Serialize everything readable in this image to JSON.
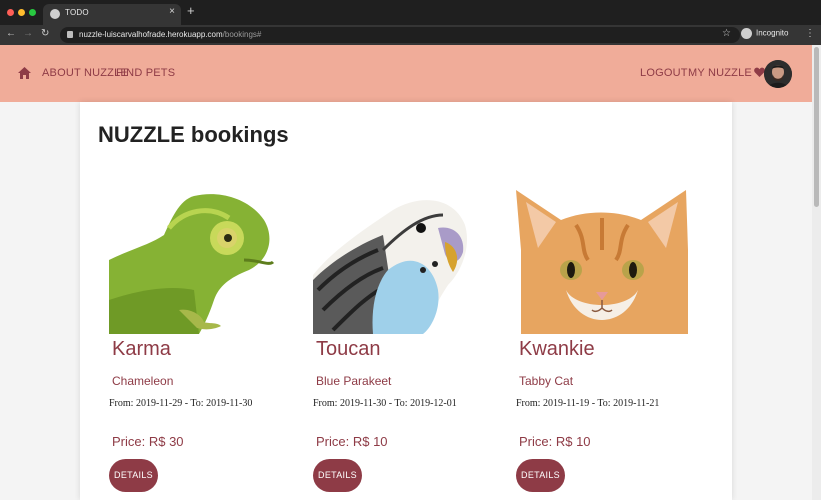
{
  "browser": {
    "tab_title": "TODO",
    "url_host": "nuzzle-luiscarvalhofrade.herokuapp.com",
    "url_path": "/bookings#",
    "profile_label": "Incognito"
  },
  "navbar": {
    "links": [
      "ABOUT NUZZLE",
      "FIND PETS"
    ],
    "logout": "LOGOUT",
    "my_nuzzle": "MY NUZZLE"
  },
  "page": {
    "title": "NUZZLE bookings"
  },
  "bookings": [
    {
      "name": "Karma",
      "breed": "Chameleon",
      "dates": "From: 2019-11-29 - To: 2019-11-30",
      "price": "Price: R$ 30",
      "button": "DETAILS"
    },
    {
      "name": "Toucan",
      "breed": "Blue Parakeet",
      "dates": "From: 2019-11-30 - To: 2019-12-01",
      "price": "Price: R$ 10",
      "button": "DETAILS"
    },
    {
      "name": "Kwankie",
      "breed": "Tabby Cat",
      "dates": "From: 2019-11-19 - To: 2019-11-21",
      "price": "Price: R$ 10",
      "button": "DETAILS"
    }
  ],
  "theme": {
    "navbar_bg": "#f0ac99",
    "accent": "#8e3b46"
  },
  "icons": {
    "home": "home-icon",
    "heart": "heart-icon",
    "lock": "lock-icon",
    "star": "star-icon"
  }
}
